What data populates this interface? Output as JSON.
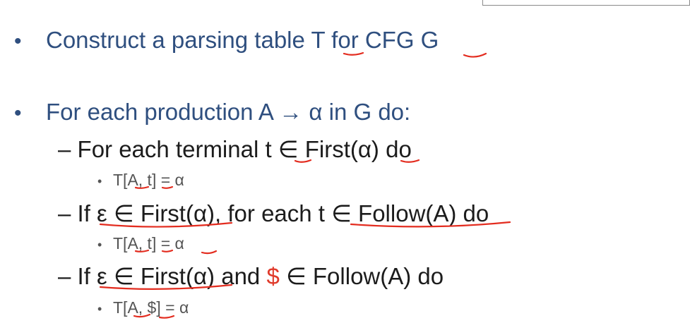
{
  "slide": {
    "bullets": [
      {
        "bullet": "•",
        "text": "Construct a parsing table T for CFG G"
      },
      {
        "bullet": "•",
        "text": "For each production  A → α in G do:"
      }
    ],
    "sub_items": [
      {
        "dash": "–",
        "text": "For each terminal t ∈ First(α) do",
        "action": {
          "bullet": "•",
          "text": "T[A, t] = α"
        }
      },
      {
        "dash": "–",
        "text_a": "If ε ∈ First(α)",
        "text_b": ", for each t ∈ Follow(A) do",
        "action": {
          "bullet": "•",
          "text": "T[A, t] = α"
        }
      },
      {
        "dash": "–",
        "text_a": "If ε ∈ First(α)",
        "text_b": " and ",
        "text_c": "$",
        "text_d": " ∈ Follow(A) do",
        "action": {
          "bullet": "•",
          "text": "T[A, $] = α"
        }
      }
    ]
  },
  "colors": {
    "heading_text": "#2f4f7f",
    "body_text": "#1c1c1c",
    "sub_text": "#555555",
    "annotation_ink": "#e32c1f"
  }
}
